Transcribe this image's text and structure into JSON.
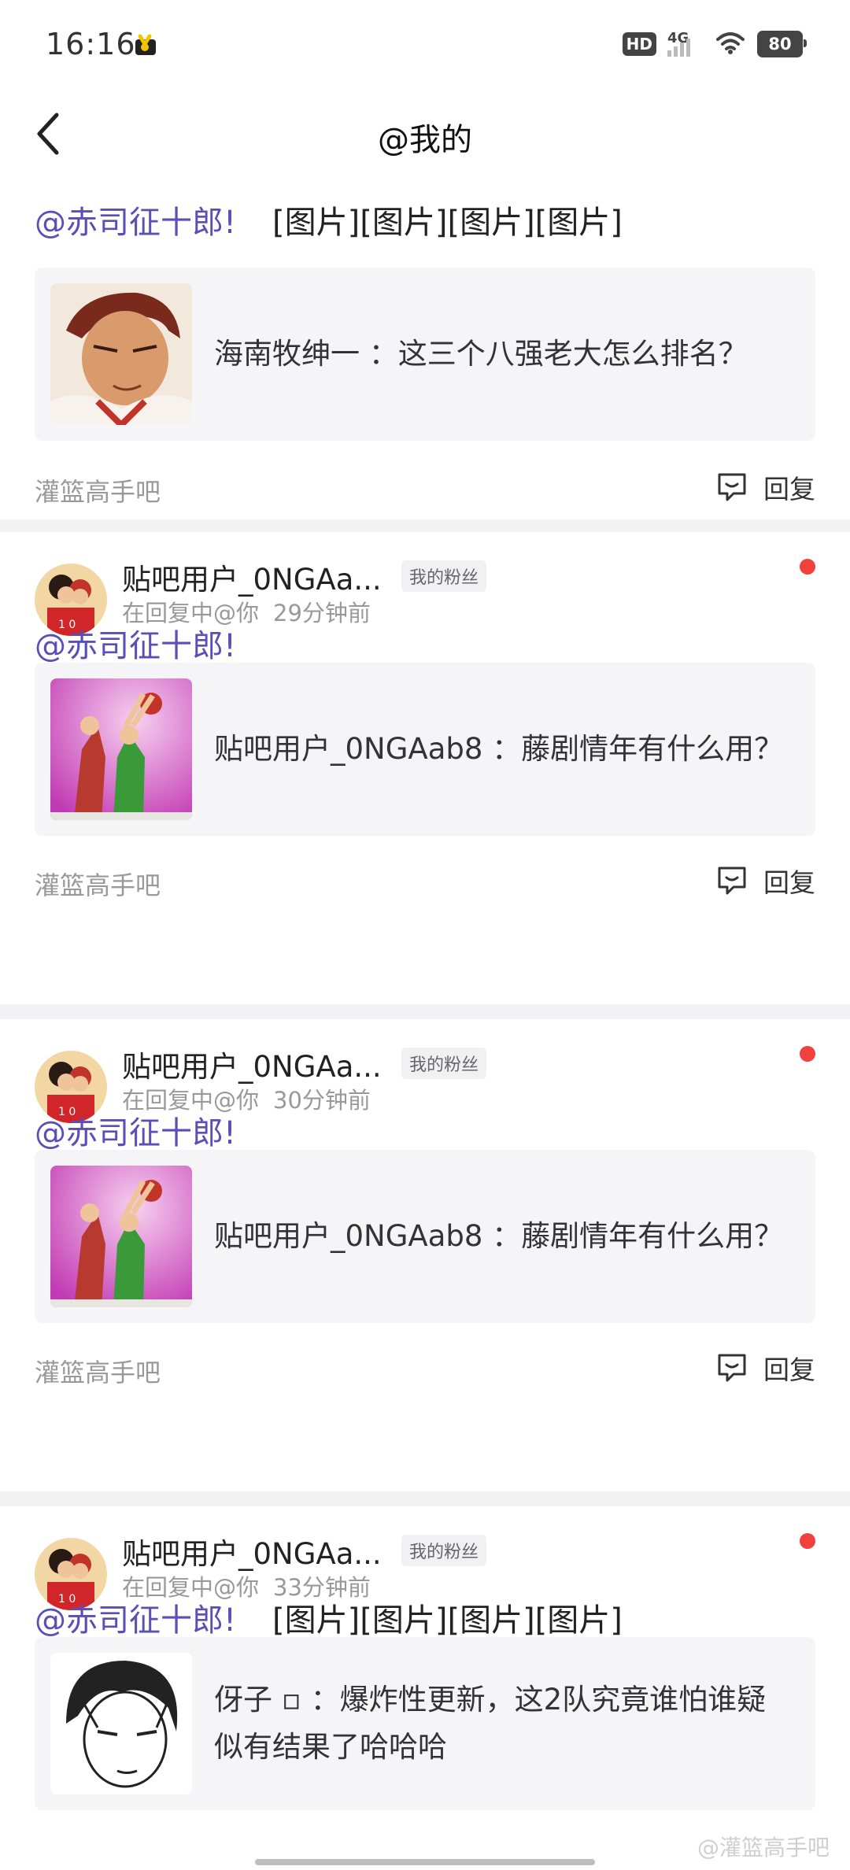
{
  "status_bar": {
    "time": "16:16",
    "hd": "HD",
    "network": "4G",
    "battery": "80"
  },
  "header": {
    "title": "@我的"
  },
  "mentions": [
    {
      "mention_text": "@赤司征十郎!",
      "attachments_text": "[图片][图片][图片][图片]",
      "quote_text": "海南牧绅一 ：这三个八强老大怎么排名？",
      "forum": "灌篮高手吧",
      "reply_label": "回复"
    },
    {
      "user_name": "贴吧用户_0NGAa...",
      "tag": "我的粉丝",
      "context": "在回复中@你",
      "time": "29分钟前",
      "mention_text": "@赤司征十郎!",
      "quote_text": "贴吧用户_0NGAab8 ：藤剧情年有什么用？",
      "forum": "灌篮高手吧",
      "reply_label": "回复"
    },
    {
      "user_name": "贴吧用户_0NGAa...",
      "tag": "我的粉丝",
      "context": "在回复中@你",
      "time": "30分钟前",
      "mention_text": "@赤司征十郎!",
      "quote_text": "贴吧用户_0NGAab8 ：藤剧情年有什么用？",
      "forum": "灌篮高手吧",
      "reply_label": "回复"
    },
    {
      "user_name": "贴吧用户_0NGAa...",
      "tag": "我的粉丝",
      "context": "在回复中@你",
      "time": "33分钟前",
      "mention_text": "@赤司征十郎!",
      "attachments_text": "[图片][图片][图片][图片]",
      "quote_text": "伢子 ▫ ：爆炸性更新，这2队究竟谁怕谁疑似有结果了哈哈哈"
    }
  ],
  "watermark": "@灌篮高手吧",
  "colors": {
    "mention": "#5a4fb6",
    "unread_dot": "#f0413d",
    "divider": "#f2f2f4"
  }
}
